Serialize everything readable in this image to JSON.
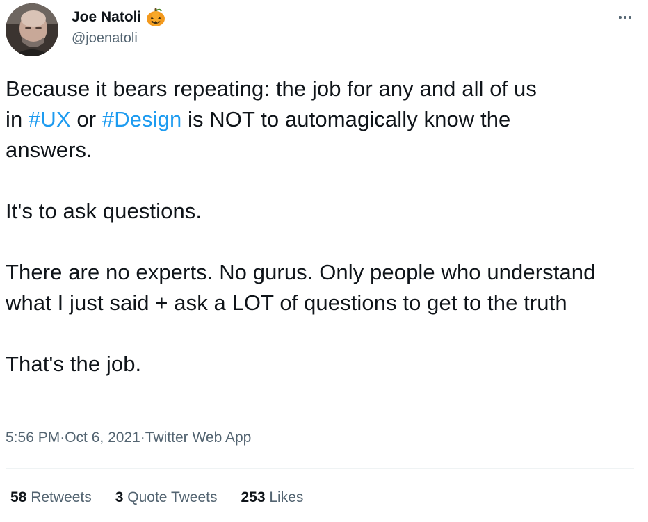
{
  "author": {
    "display_name": "Joe Natoli",
    "handle": "@joenatoli",
    "badge_icon": "pumpkin-icon",
    "avatar_icon": "avatar-photo"
  },
  "tweet": {
    "line1": "Because it bears repeating: the job for any and all of us",
    "line2_prefix": "in ",
    "hashtag1": "#UX",
    "line2_mid": " or ",
    "hashtag2": "#Design",
    "line2_suffix": " is NOT to automagically know the",
    "line3": "answers.",
    "para2": "It's to ask questions.",
    "para3": "There are no experts. No gurus. Only people who understand what I just said + ask a LOT of questions to get to the truth",
    "para4": "That's the job."
  },
  "meta": {
    "time": "5:56 PM",
    "sep1": " · ",
    "date": "Oct 6, 2021",
    "sep2": " · ",
    "source": "Twitter Web App"
  },
  "stats": {
    "retweets_count": "58",
    "retweets_label": "Retweets",
    "quotes_count": "3",
    "quotes_label": "Quote Tweets",
    "likes_count": "253",
    "likes_label": "Likes"
  },
  "colors": {
    "link": "#1d9bf0",
    "secondary_text": "#536471",
    "primary_text": "#0f1419",
    "divider": "#eff3f4"
  }
}
